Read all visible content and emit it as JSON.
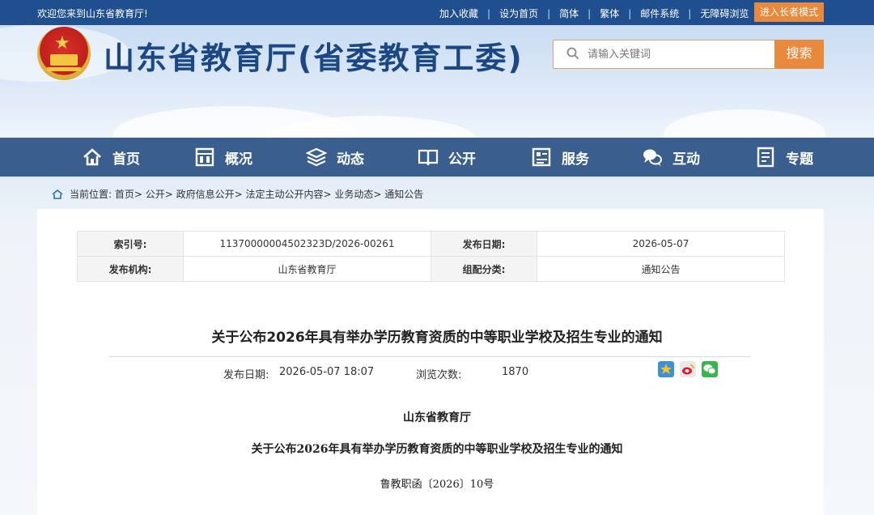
{
  "topbar": {
    "welcome": "欢迎您来到山东省教育厅!",
    "links": [
      "加入收藏",
      "设为首页",
      "简体",
      "繁体",
      "邮件系统",
      "无障碍浏览"
    ],
    "elder_mode": "进入长者模式"
  },
  "header": {
    "title": "山东省教育厅(省委教育工委)",
    "search_placeholder": "请输入关键词",
    "search_button": "搜索"
  },
  "nav": {
    "items": [
      {
        "label": "首页",
        "icon": "home-icon"
      },
      {
        "label": "概况",
        "icon": "building-icon"
      },
      {
        "label": "动态",
        "icon": "layers-icon"
      },
      {
        "label": "公开",
        "icon": "book-icon"
      },
      {
        "label": "服务",
        "icon": "service-icon"
      },
      {
        "label": "互动",
        "icon": "chat-icon"
      },
      {
        "label": "专题",
        "icon": "document-icon"
      }
    ]
  },
  "breadcrumb": {
    "text": "当前位置: 首页> 公开> 政府信息公开> 法定主动公开内容> 业务动态> 通知公告"
  },
  "meta": {
    "index_label": "索引号:",
    "index_value": "11370000004502323D/2026-00261",
    "date_label": "发布日期:",
    "date_value": "2026-05-07",
    "org_label": "发布机构:",
    "org_value": "山东省教育厅",
    "category_label": "组配分类:",
    "category_value": "通知公告"
  },
  "article": {
    "title": "关于公布2026年具有举办学历教育资质的中等职业学校及招生专业的通知",
    "pub_label": "发布日期:",
    "pub_value": "2026-05-07 18:07",
    "views_label": "浏览次数:",
    "views_value": "1870",
    "issuer": "山东省教育厅",
    "subtitle": "关于公布2026年具有举办学历教育资质的中等职业学校及招生专业的通知",
    "doc_number": "鲁教职函〔2026〕10号"
  },
  "colors": {
    "topbar": "#1f4f8f",
    "nav": "#3a5f8f",
    "title": "#1b4785",
    "accent": "#e8893c"
  }
}
